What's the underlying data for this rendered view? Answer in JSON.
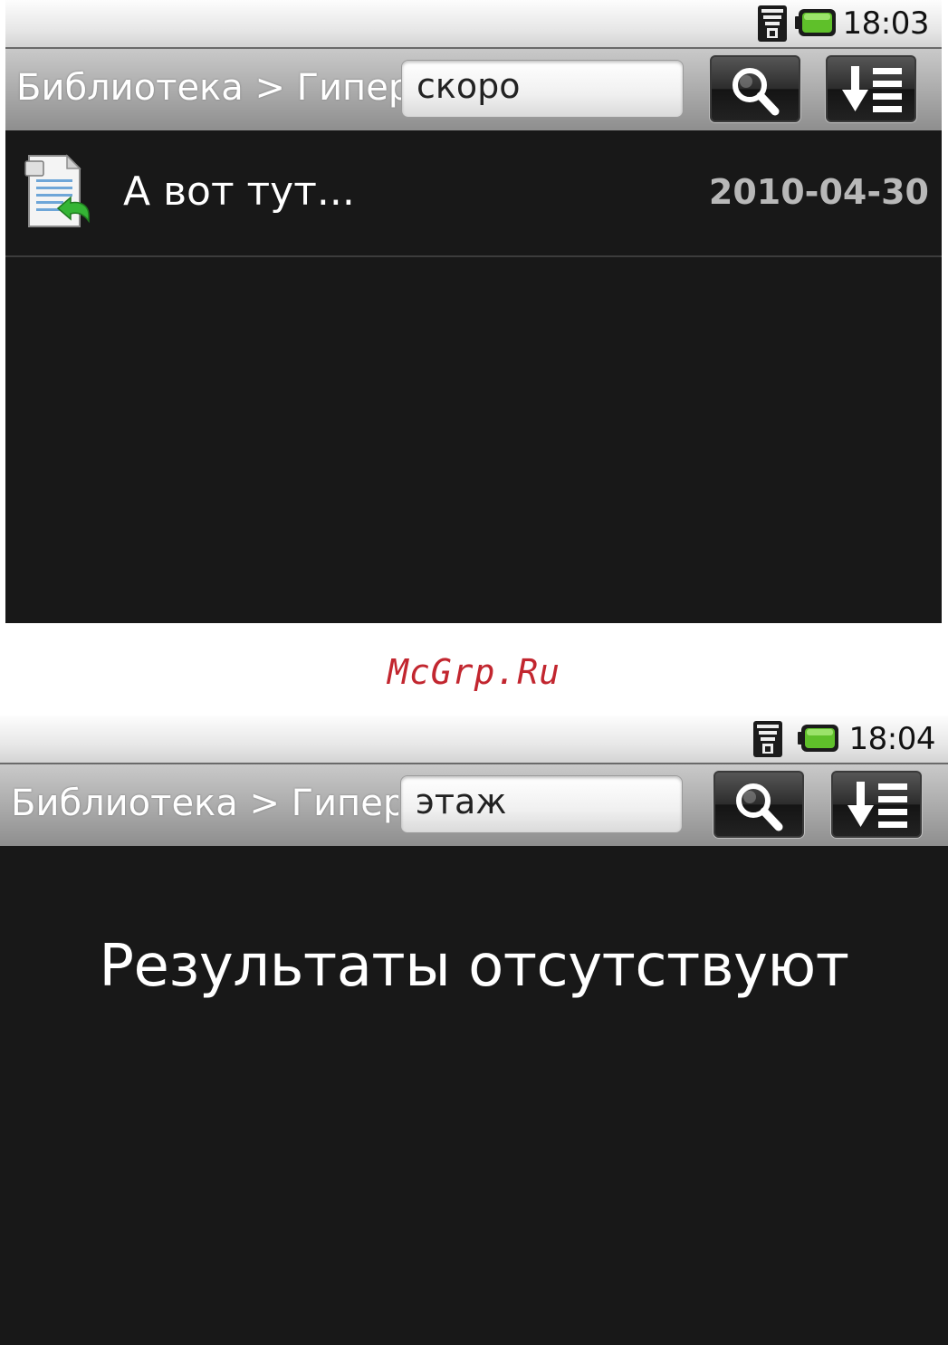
{
  "screens": [
    {
      "status": {
        "time": "18:03"
      },
      "header": {
        "breadcrumb": "Библиотека > Гиперс",
        "search_value": "скоро"
      },
      "results": [
        {
          "title": "А вот тут...",
          "date": "2010-04-30"
        }
      ]
    },
    {
      "status": {
        "time": "18:04"
      },
      "header": {
        "breadcrumb": "Библиотека > Гиперс",
        "search_value": "этаж"
      },
      "empty_message": "Результаты отсутствуют"
    }
  ],
  "watermark": "McGrp.Ru",
  "icons": {
    "signal": "wifi-signal-icon",
    "battery": "battery-icon",
    "search": "search-icon",
    "sort": "sort-icon",
    "document": "document-icon"
  },
  "colors": {
    "background": "#181818",
    "battery_fill": "#5fc02a",
    "date_text": "#b8b8b8",
    "watermark": "#c2262f"
  }
}
